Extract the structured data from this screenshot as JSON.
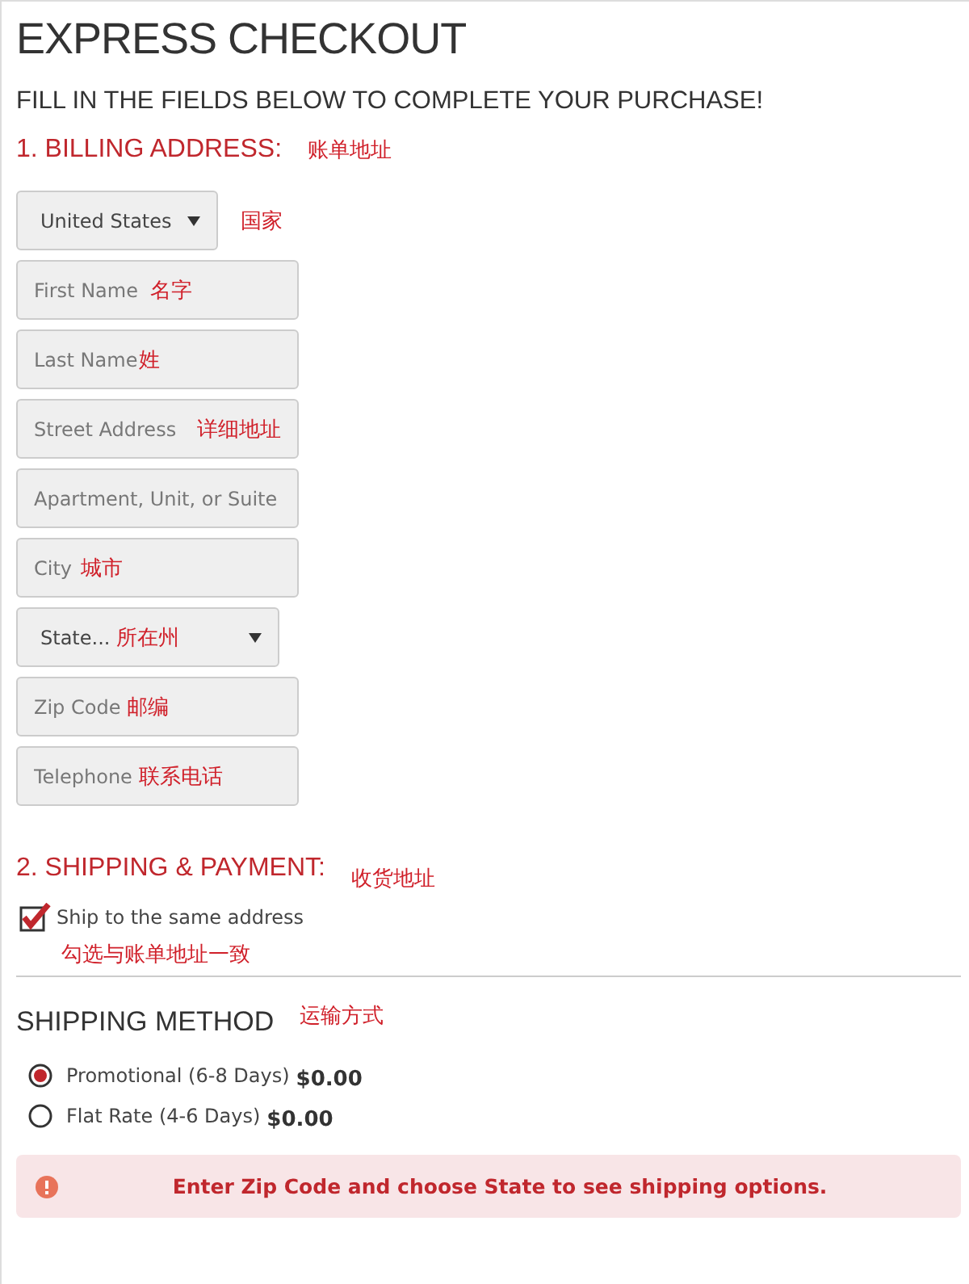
{
  "title": "EXPRESS CHECKOUT",
  "subtitle": "FILL IN THE FIELDS BELOW TO COMPLETE YOUR PURCHASE!",
  "billing": {
    "heading": "1. BILLING ADDRESS:",
    "note": "账单地址",
    "fields": [
      {
        "kind": "country-select",
        "value": "United States",
        "note": "国家"
      },
      {
        "kind": "input",
        "placeholder": "First Name",
        "note": "名字"
      },
      {
        "kind": "input",
        "placeholder": "Last Name",
        "note": "姓"
      },
      {
        "kind": "input",
        "placeholder": "Street Address",
        "note": "详细地址"
      },
      {
        "kind": "input",
        "placeholder": "Apartment, Unit, or Suite"
      },
      {
        "kind": "input",
        "placeholder": "City",
        "note": "城市"
      },
      {
        "kind": "state-select",
        "value": "State...",
        "note": "所在州"
      },
      {
        "kind": "input",
        "placeholder": "Zip Code",
        "note": "邮编"
      },
      {
        "kind": "input",
        "placeholder": "Telephone",
        "note": "联系电话"
      }
    ]
  },
  "shipping": {
    "heading": "2. SHIPPING & PAYMENT:",
    "note": "收货地址",
    "same_address": {
      "label": "Ship to the same address",
      "checked": true,
      "note": "勾选与账单地址一致"
    }
  },
  "method": {
    "heading": "SHIPPING METHOD",
    "note": "运输方式",
    "options": [
      {
        "label": "Promotional (6-8 Days)",
        "price": "$0.00",
        "selected": true
      },
      {
        "label": "Flat Rate (4-6 Days)",
        "price": "$0.00",
        "selected": false
      }
    ]
  },
  "alert": "Enter Zip Code and choose State to see shipping options."
}
